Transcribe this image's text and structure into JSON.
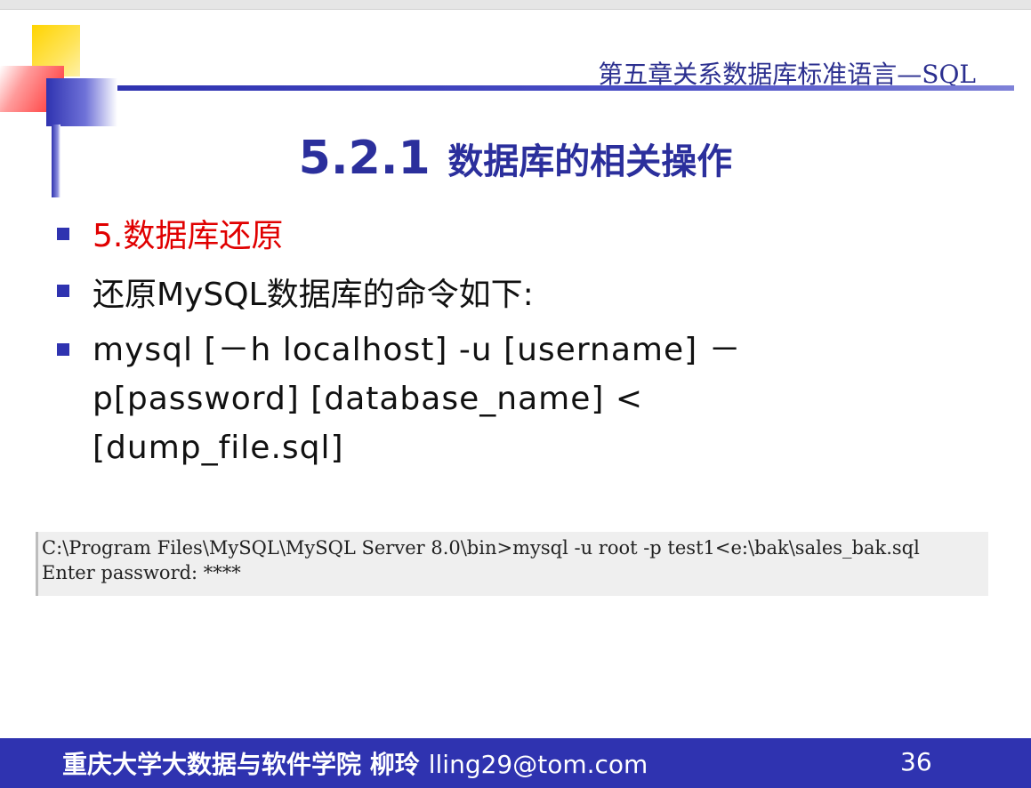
{
  "header": {
    "title": "第五章关系数据库标准语言—SQL"
  },
  "slide": {
    "number": "5.2.1",
    "title": "数据库的相关操作"
  },
  "bullets": [
    {
      "text": "5.数据库还原"
    },
    {
      "text": "还原MySQL数据库的命令如下:"
    },
    {
      "line1": "mysql [－h localhost] -u [username] －",
      "line2": "p[password] [database_name] <",
      "line3": "[dump_file.sql]"
    }
  ],
  "terminal": {
    "line1": "C:\\Program Files\\MySQL\\MySQL Server 8.0\\bin>mysql -u root -p test1<e:\\bak\\sales_bak.sql",
    "line2": "Enter password: ****"
  },
  "footer": {
    "institution": "重庆大学大数据与软件学院 柳玲",
    "email": "lling29@tom.com",
    "page": "36"
  },
  "colors": {
    "accent": "#2f33b0",
    "highlight": "#e00000",
    "yellow": "#ffd400"
  }
}
